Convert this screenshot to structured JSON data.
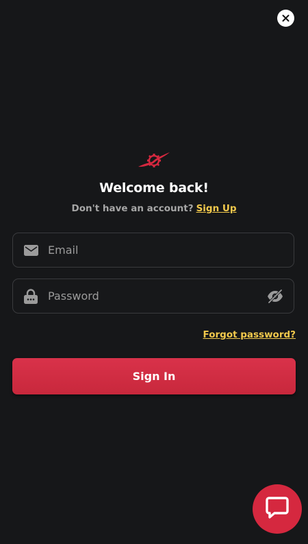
{
  "header": {
    "close_icon": "close-icon"
  },
  "logo": {
    "icon": "propeller-gear-logo",
    "color": "#d5283f"
  },
  "auth": {
    "title": "Welcome back!",
    "subtitle": "Don't have an account?",
    "signup_link": "Sign Up"
  },
  "form": {
    "email": {
      "icon": "envelope-icon",
      "placeholder": "Email",
      "value": ""
    },
    "password": {
      "icon": "lock-icon",
      "placeholder": "Password",
      "value": "",
      "toggle_icon": "eye-off-icon"
    },
    "forgot_link": "Forgot password?",
    "submit_label": "Sign In"
  },
  "chat": {
    "icon": "chat-bubble-icon"
  },
  "colors": {
    "background": "#161719",
    "accent": "#d5283f",
    "link": "#f2c94c",
    "field_border": "#3a3b3e",
    "muted_text": "#a6a6a6"
  }
}
